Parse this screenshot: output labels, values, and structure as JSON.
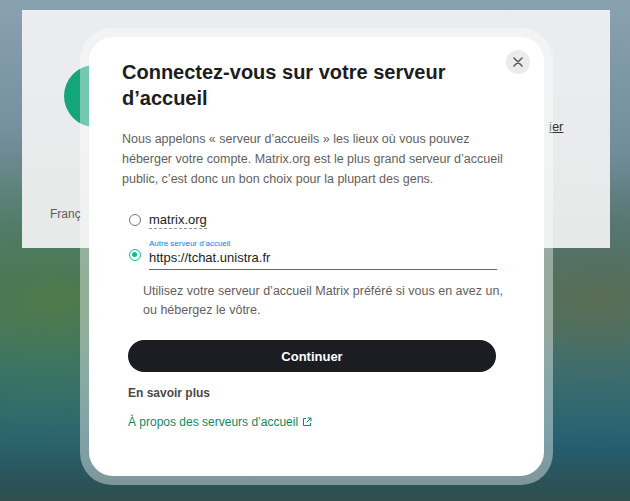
{
  "background": {
    "language": "Franç",
    "link": "ier"
  },
  "dialog": {
    "title": "Connectez-vous sur votre serveur d’accueil",
    "description": "Nous appelons « serveur d’accueils » les lieux où vous pouvez héberger votre compte. Matrix.org est le plus grand serveur d’accueil public, c’est donc un bon choix pour la plupart des gens.",
    "options": [
      {
        "kind": "preset",
        "label": "matrix.org",
        "selected": false
      },
      {
        "kind": "custom",
        "field_label": "Autre serveur d’accueil",
        "value": "https://tchat.unistra.fr",
        "selected": true
      }
    ],
    "help": "Utilisez votre serveur d’accueil Matrix préféré si vous en avez un, ou hébergez le vôtre.",
    "continue_button": "Continuer",
    "learn_more": {
      "heading": "En savoir plus",
      "link": "À propos des serveurs d’accueil"
    }
  }
}
